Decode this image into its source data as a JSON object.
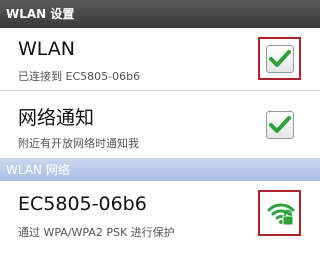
{
  "settings_header": {
    "title": "WLAN 设置"
  },
  "wlan_row": {
    "title": "WLAN",
    "subtitle": "已连接到 EC5805-06b6",
    "checked": true,
    "icon": "checkmark-icon"
  },
  "notify_row": {
    "title": "网络通知",
    "subtitle": "附近有开放网络时通知我",
    "checked": true,
    "icon": "checkmark-icon"
  },
  "network_header": {
    "title": "WLAN 网络"
  },
  "network_row": {
    "ssid": "EC5805-06b6",
    "security": "通过 WPA/WPA2 PSK 进行保护",
    "icon": "wifi-locked-icon"
  },
  "colors": {
    "check_green": "#2fa33a",
    "highlight_red": "#b0222a",
    "header_dark": "#444444",
    "header_blue": "#b3c6e7"
  }
}
